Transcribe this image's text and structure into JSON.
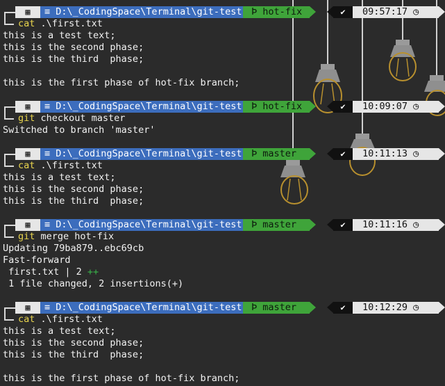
{
  "blocks": [
    {
      "prompt": {
        "os_icon": "windows-icon",
        "path_icon": "folder-icon",
        "path": "D:\\_CodingSpace\\Terminal\\git-test",
        "branch_icon": "git-branch-icon",
        "branch": "hot-fix",
        "status": "✔",
        "time": "09:57:17",
        "clock_icon": "clock-icon"
      },
      "command": {
        "name": "cat",
        "args": " .\\first.txt"
      },
      "output": [
        "this is a test text;",
        "this is the second phase;",
        "this is the third  phase;",
        "",
        "this is the first phase of hot-fix branch;"
      ]
    },
    {
      "prompt": {
        "os_icon": "windows-icon",
        "path_icon": "folder-icon",
        "path": "D:\\_CodingSpace\\Terminal\\git-test",
        "branch_icon": "git-branch-icon",
        "branch": "hot-fix",
        "status": "✔",
        "time": "10:09:07",
        "clock_icon": "clock-icon"
      },
      "command": {
        "name": "git",
        "args": " checkout master"
      },
      "output": [
        "Switched to branch 'master'"
      ]
    },
    {
      "prompt": {
        "os_icon": "windows-icon",
        "path_icon": "folder-icon",
        "path": "D:\\_CodingSpace\\Terminal\\git-test",
        "branch_icon": "git-branch-icon",
        "branch": "master",
        "status": "✔",
        "time": "10:11:13",
        "clock_icon": "clock-icon"
      },
      "command": {
        "name": "cat",
        "args": " .\\first.txt"
      },
      "output": [
        "this is a test text;",
        "this is the second phase;",
        "this is the third  phase;"
      ]
    },
    {
      "prompt": {
        "os_icon": "windows-icon",
        "path_icon": "folder-icon",
        "path": "D:\\_CodingSpace\\Terminal\\git-test",
        "branch_icon": "git-branch-icon",
        "branch": "master",
        "status": "✔",
        "time": "10:11:16",
        "clock_icon": "clock-icon"
      },
      "command": {
        "name": "git",
        "args": " merge hot-fix"
      },
      "output": [
        "Updating 79ba879..ebc69cb",
        "Fast-forward",
        " first.txt | 2 ++",
        " 1 file changed, 2 insertions(+)"
      ]
    },
    {
      "prompt": {
        "os_icon": "windows-icon",
        "path_icon": "folder-icon",
        "path": "D:\\_CodingSpace\\Terminal\\git-test",
        "branch_icon": "git-branch-icon",
        "branch": "master",
        "status": "✔",
        "time": "10:12:29",
        "clock_icon": "clock-icon"
      },
      "command": {
        "name": "cat",
        "args": " .\\first.txt"
      },
      "output": [
        "this is a test text;",
        "this is the second phase;",
        "this is the third  phase;",
        "",
        "this is the first phase of hot-fix branch;"
      ]
    }
  ],
  "colors": {
    "background": "#2b2b2b",
    "path_segment": "#3c6dbd",
    "git_segment": "#3fa43a",
    "os_segment": "#e6e6e6",
    "time_segment": "#e6e6e6",
    "status_segment": "#111111",
    "command_name": "#e8d44d",
    "text": "#f2f2f2"
  }
}
